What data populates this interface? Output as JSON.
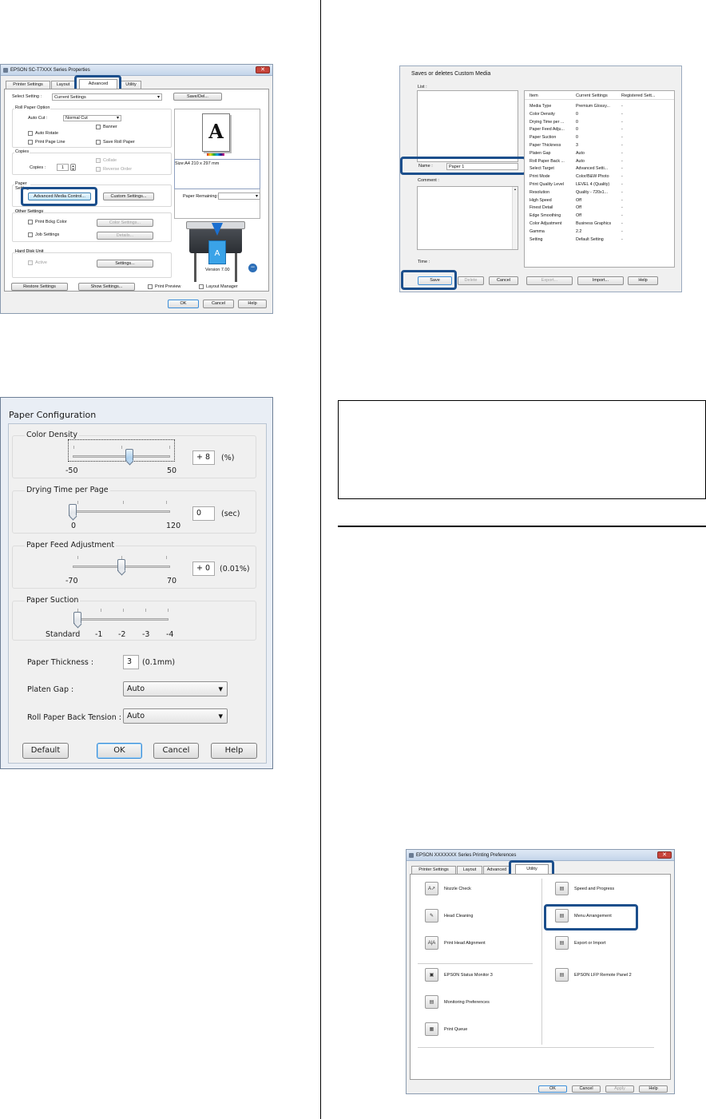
{
  "shot_advanced": {
    "title": "EPSON SC-T7XXX Series Properties",
    "tabs": [
      "Printer Settings",
      "Layout",
      "Advanced",
      "Utility"
    ],
    "select_setting_label": "Select Setting :",
    "select_setting_value": "Current Settings",
    "save_del_button": "Save/Del...",
    "roll_paper_option_label": "Roll Paper Option",
    "auto_cut_label": "Auto Cut :",
    "auto_cut_value": "Normal Cut",
    "banner": "Banner",
    "auto_rotate": "Auto Rotate",
    "print_page_line": "Print Page Line",
    "save_roll_paper": "Save Roll Paper",
    "copies_group": "Copies",
    "copies_label": "Copies :",
    "copies_value": "1",
    "collate": "Collate",
    "reverse_order": "Reverse Order",
    "size_text": "Size:A4 210 x 297 mm",
    "paper_group": "Paper Settings",
    "advanced_media_control_button": "Advanced Media Control...",
    "custom_settings_button": "Custom Settings...",
    "paper_remaining_label": "Paper Remaining:",
    "other_settings_group": "Other Settings",
    "print_bckg_color": "Print Bckg Color",
    "color_settings_button": "Color Settings...",
    "job_settings": "Job Settings",
    "details_button": "Details...",
    "hard_disk_group": "Hard Disk Unit",
    "active": "Active",
    "hd_settings_button": "Settings...",
    "version": "Version 7.00",
    "restore_button": "Restore Settings",
    "show_settings_button": "Show Settings...",
    "print_preview": "Print Preview",
    "layout_manager": "Layout Manager",
    "ok": "OK",
    "cancel": "Cancel",
    "help": "Help"
  },
  "shot_custom_media": {
    "title": "Saves or deletes Custom Media",
    "list_label": "List :",
    "name_label": "Name :",
    "name_value": "Paper 1",
    "comment_label": "Comment :",
    "time_label": "Time :",
    "headers": [
      "Item",
      "Current Settings",
      "Registered Sett..."
    ],
    "rows": [
      [
        "Media Type",
        "Premium Glossy...",
        "-"
      ],
      [
        "Color Density",
        "0",
        "-"
      ],
      [
        "Drying Time per ...",
        "0",
        "-"
      ],
      [
        "Paper Feed Adju...",
        "0",
        "-"
      ],
      [
        "Paper Suction",
        "0",
        "-"
      ],
      [
        "Paper Thickness",
        "3",
        "-"
      ],
      [
        "Platen Gap",
        "Auto",
        "-"
      ],
      [
        "Roll Paper Back ...",
        "Auto",
        "-"
      ],
      [
        "Select Target",
        "Advanced Setti...",
        "-"
      ],
      [
        "Print Mode",
        "Color/B&W Photo",
        "-"
      ],
      [
        "Print Quality Level",
        "LEVEL 4 (Quality)",
        "-"
      ],
      [
        "Resolution",
        "Quality - 720x1...",
        "-"
      ],
      [
        "High Speed",
        "Off",
        "-"
      ],
      [
        "Finest Detail",
        "Off",
        "-"
      ],
      [
        "Edge Smoothing",
        "Off",
        "-"
      ],
      [
        "Color Adjustment",
        "Business Graphics",
        "-"
      ],
      [
        "Gamma",
        "2.2",
        "-"
      ],
      [
        "Setting",
        "Default Setting",
        "-"
      ]
    ],
    "save": "Save",
    "delete": "Delete",
    "cancel": "Cancel",
    "export": "Export...",
    "import": "Import...",
    "help": "Help"
  },
  "paper_config": {
    "title": "Paper Configuration",
    "color_density": {
      "label": "Color Density",
      "min": "-50",
      "max": "50",
      "value": "+ 8",
      "unit": "(%)",
      "level": 0.58
    },
    "drying_time": {
      "label": "Drying Time per Page",
      "min": "0",
      "max": "120",
      "value": "0",
      "unit": "(sec)",
      "level": 0.0
    },
    "paper_feed": {
      "label": "Paper Feed Adjustment",
      "min": "-70",
      "max": "70",
      "value": "+ 0",
      "unit": "(0.01%)",
      "level": 0.5
    },
    "paper_suction": {
      "label": "Paper Suction",
      "ticks": [
        "Standard",
        "-1",
        "-2",
        "-3",
        "-4"
      ]
    },
    "thickness_label": "Paper Thickness :",
    "thickness_value": "3",
    "thickness_unit": "(0.1mm)",
    "platen_label": "Platen Gap :",
    "platen_value": "Auto",
    "tension_label": "Roll Paper Back Tension :",
    "tension_value": "Auto",
    "default": "Default",
    "ok": "OK",
    "cancel": "Cancel",
    "help": "Help"
  },
  "shot_utility": {
    "title": "EPSON XXXXXXX Series Printing Preferences",
    "tabs": [
      "Printer Settings",
      "Layout",
      "Advanced",
      "Utility"
    ],
    "left_items": [
      "Nozzle Check",
      "Head Cleaning",
      "Print Head Alignment",
      "EPSON Status Monitor 3",
      "Monitoring Preferences",
      "Print Queue"
    ],
    "right_items": [
      "Speed and Progress",
      "Menu Arrangement",
      "Export or Import",
      "EPSON LFP Remote Panel 2"
    ],
    "ok": "OK",
    "cancel": "Cancel",
    "apply": "Apply",
    "help": "Help"
  }
}
